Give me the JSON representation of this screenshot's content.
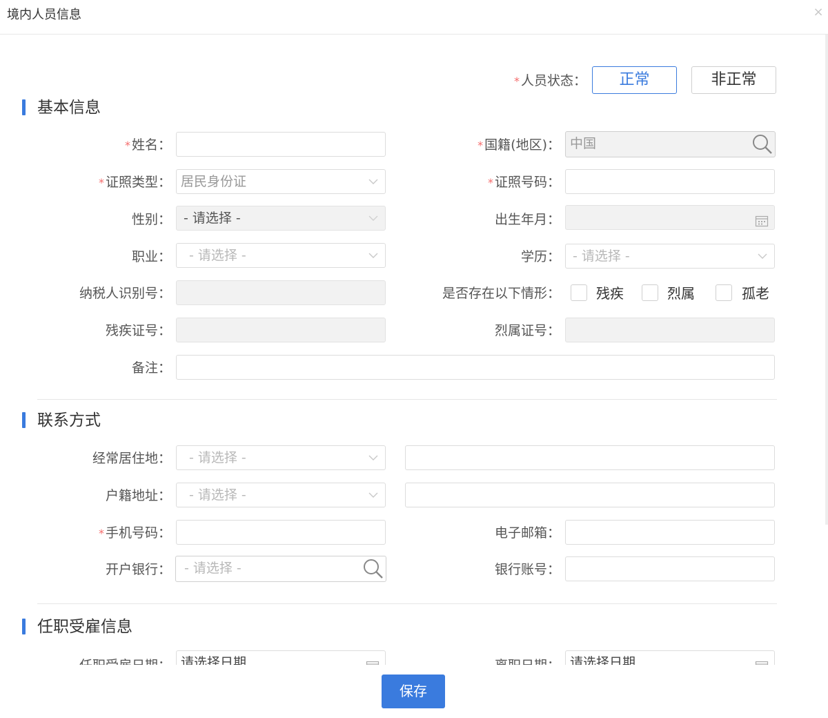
{
  "dialog": {
    "title": "境内人员信息",
    "close_glyph": "×"
  },
  "status": {
    "label": "人员状态：",
    "options": [
      "正常",
      "非正常"
    ],
    "selected": "正常"
  },
  "sections": {
    "basic": "基本信息",
    "contact": "联系方式",
    "employment": "任职受雇信息"
  },
  "basic": {
    "name_label": "姓名：",
    "name_value": "",
    "nationality_label": "国籍(地区)：",
    "nationality_value": "中国",
    "id_type_label": "证照类型：",
    "id_type_value": "居民身份证",
    "id_number_label": "证照号码：",
    "id_number_value": "",
    "gender_label": "性别：",
    "gender_value": "- 请选择 -",
    "birth_label": "出生年月：",
    "birth_value": "",
    "occupation_label": "职业：",
    "occupation_value": "- 请选择 -",
    "education_label": "学历：",
    "education_value": "- 请选择 -",
    "taxpayer_label": "纳税人识别号：",
    "taxpayer_value": "",
    "situation_label": "是否存在以下情形：",
    "situations": [
      "残疾",
      "烈属",
      "孤老"
    ],
    "disability_no_label": "残疾证号：",
    "martyr_no_label": "烈属证号：",
    "remark_label": "备注："
  },
  "contact": {
    "residence_label": "经常居住地：",
    "residence_value": "- 请选择 -",
    "household_label": "户籍地址：",
    "household_value": "- 请选择 -",
    "mobile_label": "手机号码：",
    "email_label": "电子邮箱：",
    "bank_label": "开户银行：",
    "bank_value": "- 请选择 -",
    "account_label": "银行账号："
  },
  "employment": {
    "hire_date_label": "任职受雇日期：",
    "hire_date_placeholder": "请选择日期",
    "leave_date_label": "离职日期：",
    "leave_date_placeholder": "请选择日期"
  },
  "footer": {
    "save_label": "保存"
  },
  "colors": {
    "accent": "#3a7bde",
    "required": "#f56c6c"
  },
  "icons": [
    "close-icon",
    "search-icon",
    "calendar-icon",
    "chevron-down-icon"
  ]
}
